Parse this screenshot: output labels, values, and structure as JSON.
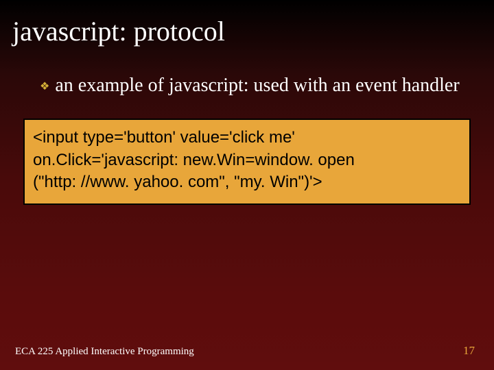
{
  "slide": {
    "title": "javascript: protocol",
    "bullet": {
      "text": "an example of javascript: used with an event handler"
    },
    "code": {
      "line1": "<input type='button' value='click me'",
      "line2": " on.Click='javascript: new.Win=window. open",
      "line3": " (\"http: //www. yahoo. com\", \"my. Win\")'>"
    },
    "footer": {
      "left": "ECA 225   Applied Interactive Programming",
      "right": "17"
    }
  }
}
